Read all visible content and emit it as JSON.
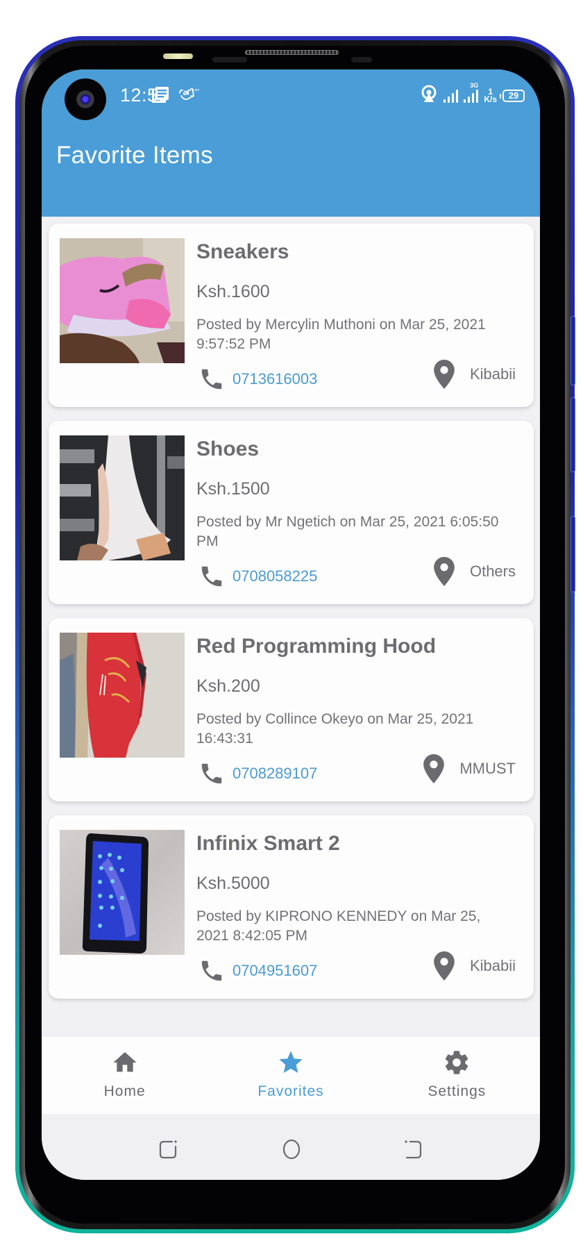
{
  "status_bar": {
    "time": "12:56",
    "left_icons": [
      "news-icon",
      "carl-app-icon"
    ],
    "right_icons": [
      "hotspot-icon",
      "signal-icon",
      "signal-3g-icon"
    ],
    "network_type": "3G",
    "speed_value": "1",
    "speed_unit": "K/s",
    "battery": "29"
  },
  "header": {
    "title": "Favorite Items",
    "background_color": "#4a9dd6"
  },
  "items": [
    {
      "title": "Sneakers",
      "price": "Ksh.1600",
      "posted": "Posted by Mercylin Muthoni on Mar 25, 2021 9:57:52 PM",
      "phone": "0713616003",
      "location": "Kibabii",
      "image": "pink-sneaker-photo"
    },
    {
      "title": "Shoes",
      "price": "Ksh.1500",
      "posted": "Posted by Mr Ngetich on Mar 25, 2021 6:05:50 PM",
      "phone": "0708058225",
      "location": "Others",
      "image": "white-heel-shoe-photo"
    },
    {
      "title": "Red Programming Hood",
      "price": "Ksh.200",
      "posted": "Posted by Collince Okeyo on Mar 25, 2021 16:43:31",
      "phone": "0708289107",
      "location": "MMUST",
      "image": "red-hoodie-photo"
    },
    {
      "title": "Infinix Smart 2",
      "price": "Ksh.5000",
      "posted": "Posted by KIPRONO KENNEDY on Mar 25, 2021 8:42:05 PM",
      "phone": "0704951607",
      "location": "Kibabii",
      "image": "smartphone-photo"
    }
  ],
  "bottom_nav": {
    "items": [
      {
        "label": "Home",
        "icon": "home-icon",
        "active": false
      },
      {
        "label": "Favorites",
        "icon": "star-icon",
        "active": true
      },
      {
        "label": "Settings",
        "icon": "gear-icon",
        "active": false
      }
    ],
    "active_color": "#4a9dd6",
    "inactive_color": "#6b6a6e"
  },
  "system_nav": [
    "recent-apps-button",
    "home-button",
    "back-button"
  ],
  "colors": {
    "link": "#4a9bd2",
    "text": "#6d6c70"
  }
}
